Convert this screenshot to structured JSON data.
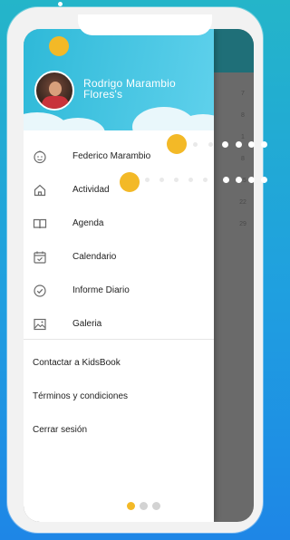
{
  "user": {
    "name": "Rodrigo Marambio Flores's"
  },
  "menu": {
    "items": [
      {
        "label": "Federico Marambio",
        "icon": "child-face-icon"
      },
      {
        "label": "Actividad",
        "icon": "home-icon"
      },
      {
        "label": "Agenda",
        "icon": "book-icon"
      },
      {
        "label": "Calendario",
        "icon": "calendar-icon"
      },
      {
        "label": "Informe Diario",
        "icon": "check-circle-icon"
      },
      {
        "label": "Galeria",
        "icon": "gallery-icon"
      }
    ]
  },
  "footer": {
    "contact": "Contactar a KidsBook",
    "terms": "Términos y condiciones",
    "logout": "Cerrar sesión"
  },
  "background_calendar": {
    "days": [
      "7",
      "8",
      "1",
      "8",
      "15",
      "22",
      "29"
    ]
  },
  "colors": {
    "accent": "#f3b927",
    "header": "#2eb9d8"
  },
  "pagination": {
    "current": 1,
    "total": 3
  }
}
